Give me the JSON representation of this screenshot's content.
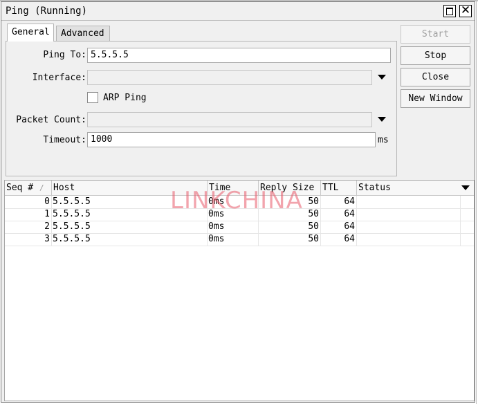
{
  "window": {
    "title": "Ping (Running)"
  },
  "tabs": [
    {
      "label": "General",
      "active": true
    },
    {
      "label": "Advanced",
      "active": false
    }
  ],
  "form": {
    "ping_to": {
      "label": "Ping To:",
      "value": "5.5.5.5"
    },
    "interface": {
      "label": "Interface:",
      "value": ""
    },
    "arp_ping": {
      "label": "ARP Ping",
      "checked": false
    },
    "packet_count": {
      "label": "Packet Count:",
      "value": ""
    },
    "timeout": {
      "label": "Timeout:",
      "value": "1000",
      "unit": "ms"
    }
  },
  "buttons": {
    "start": "Start",
    "stop": "Stop",
    "close": "Close",
    "new_window": "New Window"
  },
  "table": {
    "columns": [
      "Seq #",
      "Host",
      "Time",
      "Reply Size",
      "TTL",
      "Status"
    ],
    "sort_indicator": "/",
    "rows": [
      {
        "seq": "0",
        "host": "5.5.5.5",
        "time": "0ms",
        "reply_size": "50",
        "ttl": "64",
        "status": ""
      },
      {
        "seq": "1",
        "host": "5.5.5.5",
        "time": "0ms",
        "reply_size": "50",
        "ttl": "64",
        "status": ""
      },
      {
        "seq": "2",
        "host": "5.5.5.5",
        "time": "0ms",
        "reply_size": "50",
        "ttl": "64",
        "status": ""
      },
      {
        "seq": "3",
        "host": "5.5.5.5",
        "time": "0ms",
        "reply_size": "50",
        "ttl": "64",
        "status": ""
      }
    ]
  },
  "watermark": "LINKCHINA"
}
